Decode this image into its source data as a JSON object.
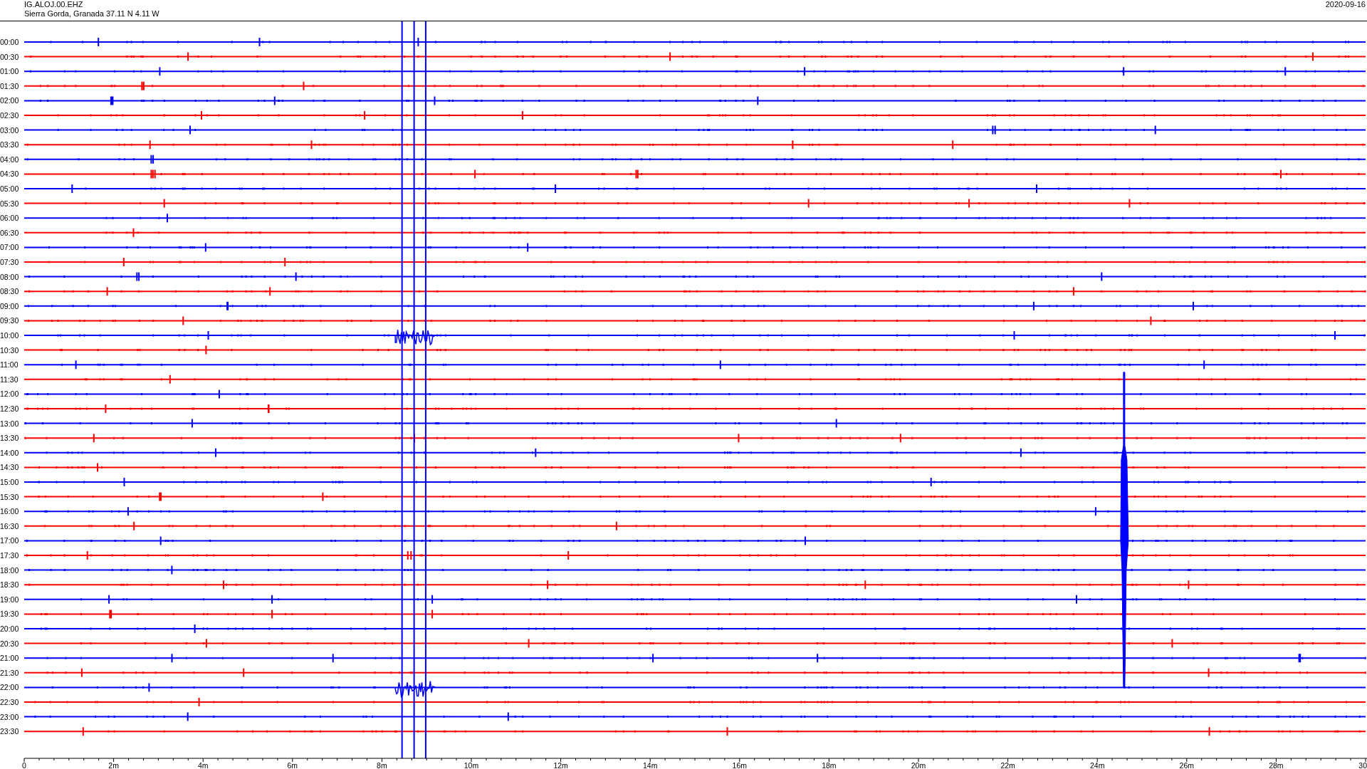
{
  "header": {
    "station": "IG.ALOJ.00.EHZ",
    "location": "Sierra Gorda, Granada  37.11 N 4.11 W",
    "date": "2020-09-16"
  },
  "rows": [
    {
      "label": "00:00",
      "color": "#0000ff"
    },
    {
      "label": "00:30",
      "color": "#ff0000"
    },
    {
      "label": "01:00",
      "color": "#0000ff"
    },
    {
      "label": "01:30",
      "color": "#ff0000"
    },
    {
      "label": "02:00",
      "color": "#0000ff"
    },
    {
      "label": "02:30",
      "color": "#ff0000"
    },
    {
      "label": "03:00",
      "color": "#0000ff"
    },
    {
      "label": "03:30",
      "color": "#ff0000"
    },
    {
      "label": "04:00",
      "color": "#0000ff"
    },
    {
      "label": "04:30",
      "color": "#ff0000"
    },
    {
      "label": "05:00",
      "color": "#0000ff"
    },
    {
      "label": "05:30",
      "color": "#ff0000"
    },
    {
      "label": "06:00",
      "color": "#0000ff"
    },
    {
      "label": "06:30",
      "color": "#ff0000"
    },
    {
      "label": "07:00",
      "color": "#0000ff"
    },
    {
      "label": "07:30",
      "color": "#ff0000"
    },
    {
      "label": "08:00",
      "color": "#0000ff"
    },
    {
      "label": "08:30",
      "color": "#ff0000"
    },
    {
      "label": "09:00",
      "color": "#0000ff"
    },
    {
      "label": "09:30",
      "color": "#ff0000"
    },
    {
      "label": "10:00",
      "color": "#0000ff"
    },
    {
      "label": "10:30",
      "color": "#ff0000"
    },
    {
      "label": "11:00",
      "color": "#0000ff"
    },
    {
      "label": "11:30",
      "color": "#ff0000"
    },
    {
      "label": "12:00",
      "color": "#0000ff"
    },
    {
      "label": "12:30",
      "color": "#ff0000"
    },
    {
      "label": "13:00",
      "color": "#0000ff"
    },
    {
      "label": "13:30",
      "color": "#ff0000"
    },
    {
      "label": "14:00",
      "color": "#0000ff"
    },
    {
      "label": "14:30",
      "color": "#ff0000"
    },
    {
      "label": "15:00",
      "color": "#0000ff"
    },
    {
      "label": "15:30",
      "color": "#ff0000"
    },
    {
      "label": "16:00",
      "color": "#0000ff"
    },
    {
      "label": "16:30",
      "color": "#ff0000"
    },
    {
      "label": "17:00",
      "color": "#0000ff"
    },
    {
      "label": "17:30",
      "color": "#ff0000"
    },
    {
      "label": "18:00",
      "color": "#0000ff"
    },
    {
      "label": "18:30",
      "color": "#ff0000"
    },
    {
      "label": "19:00",
      "color": "#0000ff"
    },
    {
      "label": "19:30",
      "color": "#ff0000"
    },
    {
      "label": "20:00",
      "color": "#0000ff"
    },
    {
      "label": "20:30",
      "color": "#ff0000"
    },
    {
      "label": "21:00",
      "color": "#0000ff"
    },
    {
      "label": "21:30",
      "color": "#ff0000"
    },
    {
      "label": "22:00",
      "color": "#0000ff"
    },
    {
      "label": "22:30",
      "color": "#ff0000"
    },
    {
      "label": "23:00",
      "color": "#0000ff"
    },
    {
      "label": "23:30",
      "color": "#ff0000"
    }
  ],
  "x_axis": {
    "ticks": [
      "0",
      "2m",
      "4m",
      "6m",
      "8m",
      "10m",
      "12m",
      "14m",
      "16m",
      "18m",
      "20m",
      "22m",
      "24m",
      "26m",
      "28m",
      "30"
    ]
  }
}
